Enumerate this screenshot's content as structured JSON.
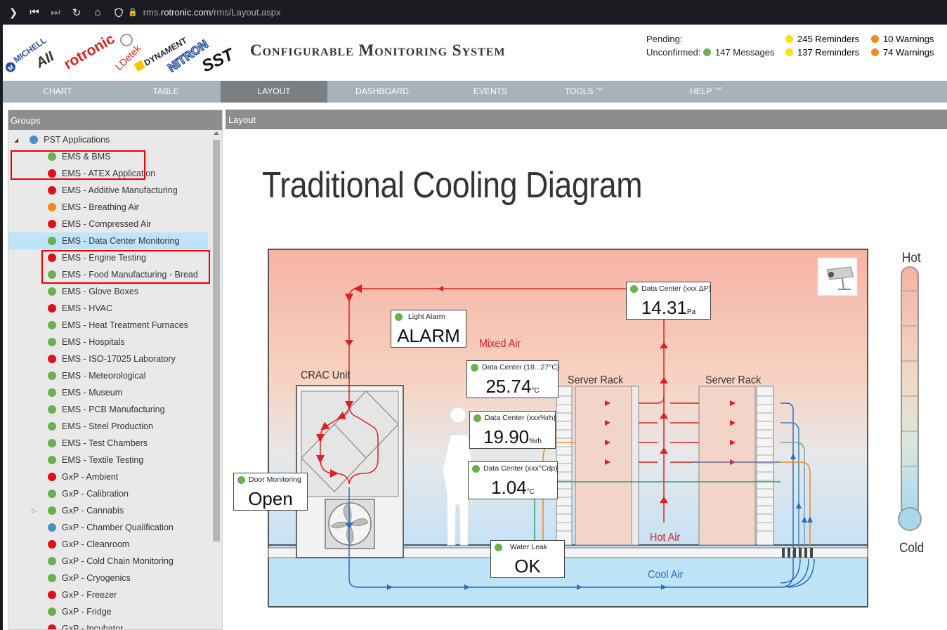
{
  "browser": {
    "url_prefix": "rms.",
    "url_host": "rotronic.com",
    "url_path": "/rms/Layout.aspx"
  },
  "header": {
    "title": "Configurable Monitoring System",
    "logos": [
      "MICHELL",
      "AII",
      "rotronic",
      "LDetek",
      "DYNAMENT",
      "NITRON",
      "SST"
    ],
    "pending_label": "Pending:",
    "unconfirmed_label": "Unconfirmed:",
    "messages": "147 Messages",
    "reminders_pending": "245 Reminders",
    "reminders_unconfirmed": "137 Reminders",
    "warnings_pending": "10 Warnings",
    "warnings_unconfirmed": "74 Warnings"
  },
  "menu": {
    "items": [
      "CHART",
      "TABLE",
      "LAYOUT",
      "DASHBOARD",
      "EVENTS",
      "TOOLS",
      "HELP"
    ],
    "active": "LAYOUT"
  },
  "groups": {
    "title": "Groups",
    "root": "PST Applications",
    "items": [
      {
        "label": "EMS & BMS",
        "status": "green"
      },
      {
        "label": "EMS - ATEX Application",
        "status": "red"
      },
      {
        "label": "EMS - Additive Manufacturing",
        "status": "red"
      },
      {
        "label": "EMS - Breathing Air",
        "status": "orange"
      },
      {
        "label": "EMS - Compressed Air",
        "status": "red"
      },
      {
        "label": "EMS - Data Center Monitoring",
        "status": "green"
      },
      {
        "label": "EMS - Engine Testing",
        "status": "red"
      },
      {
        "label": "EMS - Food Manufacturing - Bread",
        "status": "green"
      },
      {
        "label": "EMS - Glove Boxes",
        "status": "green"
      },
      {
        "label": "EMS - HVAC",
        "status": "red"
      },
      {
        "label": "EMS - Heat Treatment Furnaces",
        "status": "green"
      },
      {
        "label": "EMS - Hospitals",
        "status": "green"
      },
      {
        "label": "EMS - ISO-17025 Laboratory",
        "status": "red"
      },
      {
        "label": "EMS - Meteorological",
        "status": "green"
      },
      {
        "label": "EMS - Museum",
        "status": "green"
      },
      {
        "label": "EMS - PCB Manufacturing",
        "status": "green"
      },
      {
        "label": "EMS - Steel Production",
        "status": "green"
      },
      {
        "label": "EMS - Test Chambers",
        "status": "green"
      },
      {
        "label": "EMS - Textile Testing",
        "status": "green"
      },
      {
        "label": "GxP - Ambient",
        "status": "red"
      },
      {
        "label": "GxP - Calibration",
        "status": "green"
      },
      {
        "label": "GxP - Cannabis",
        "status": "green"
      },
      {
        "label": "GxP - Chamber Qualification",
        "status": "blue"
      },
      {
        "label": "GxP - Cleanroom",
        "status": "red"
      },
      {
        "label": "GxP - Cold Chain Monitoring",
        "status": "green"
      },
      {
        "label": "GxP - Cryogenics",
        "status": "green"
      },
      {
        "label": "GxP - Freezer",
        "status": "red"
      },
      {
        "label": "GxP - Fridge",
        "status": "green"
      },
      {
        "label": "GxP - Incubator",
        "status": "red"
      }
    ]
  },
  "layout": {
    "panel_title": "Layout",
    "diagram_title": "Traditional Cooling Diagram",
    "labels": {
      "crac": "CRAC Unit",
      "server_rack_1": "Server Rack",
      "server_rack_2": "Server Rack",
      "mixed_air": "Mixed Air",
      "hot_air": "Hot Air",
      "cool_air": "Cool Air",
      "hot": "Hot",
      "cold": "Cold"
    },
    "sensors": {
      "light_alarm": {
        "label": "Light Alarm",
        "value": "ALARM"
      },
      "pressure": {
        "label": "Data Center (xxx ΔP)",
        "value": "14.31",
        "unit": "Pa"
      },
      "temperature": {
        "label": "Data Center (18...27°C)",
        "value": "25.74",
        "unit": "°C"
      },
      "humidity": {
        "label": "Data Center (xxx%rh)",
        "value": "19.90",
        "unit": "%rh"
      },
      "dewpoint": {
        "label": "Data Center (xxx°Cdp)",
        "value": "1.04",
        "unit": "°C"
      },
      "door": {
        "label": "Door Monitoring",
        "value": "Open"
      },
      "water_leak": {
        "label": "Water Leak",
        "value": "OK"
      }
    }
  },
  "colors": {
    "green": "#6ab04c",
    "red": "#e0101a",
    "orange": "#f08a1c",
    "blue": "#4a90c8",
    "yellow": "#f5e50a"
  }
}
